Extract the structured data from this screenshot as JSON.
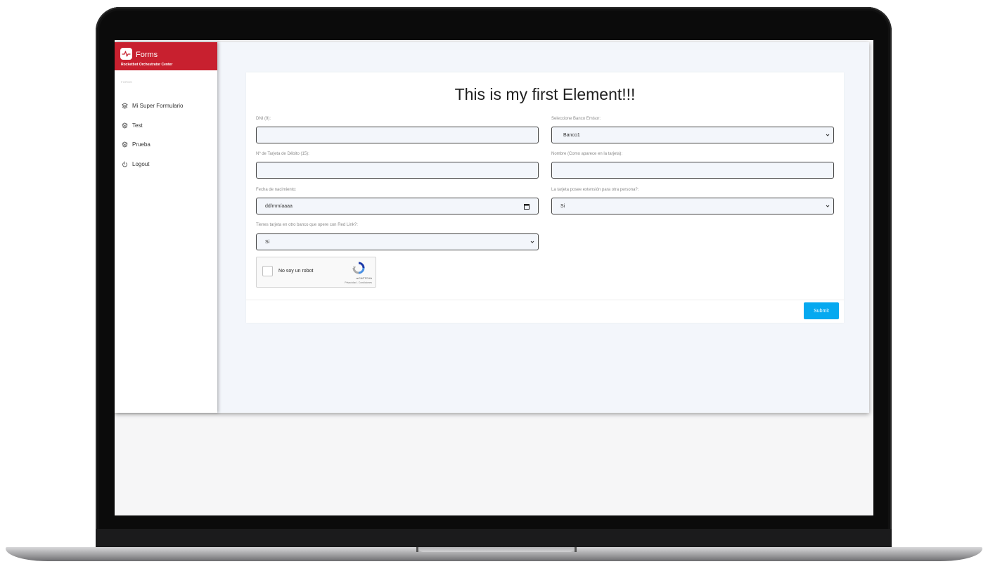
{
  "brand": {
    "title": "Forms",
    "subtitle": "Rocketbot Orchestrator Center",
    "section_label": "FORMS",
    "accent_color": "#c8202f",
    "logo_icon": "activity-icon"
  },
  "sidebar": {
    "items": [
      {
        "label": "Mi Super Formulario",
        "icon": "layers-icon"
      },
      {
        "label": "Test",
        "icon": "layers-icon"
      },
      {
        "label": "Prueba",
        "icon": "layers-icon"
      },
      {
        "label": "Logout",
        "icon": "power-icon"
      }
    ]
  },
  "form": {
    "title": "This is my first Element!!!",
    "fields": {
      "dni": {
        "label": "DNI (9):",
        "value": ""
      },
      "banco": {
        "label": "Seleccione Banco Emisor:",
        "value": "Banco1"
      },
      "tarjeta": {
        "label": "Nº de Tarjeta de Débito (15):",
        "value": ""
      },
      "nombre": {
        "label": "Nombre (Como aparece en la tarjeta):",
        "value": ""
      },
      "fecha": {
        "label": "Fecha de nacimiento:",
        "placeholder": "dd/mm/aaaa"
      },
      "extension": {
        "label": "La tarjeta posee extensión para otra persona?:",
        "value": "Si"
      },
      "redlink": {
        "label": "Tienes tarjeta en otro banco que opere con Red Link?:",
        "value": "Si"
      }
    },
    "captcha": {
      "label": "No soy un robot",
      "brand": "reCAPTCHA",
      "links": "Privacidad - Condiciones"
    },
    "submit_label": "Submit",
    "submit_color": "#06a9f0"
  }
}
